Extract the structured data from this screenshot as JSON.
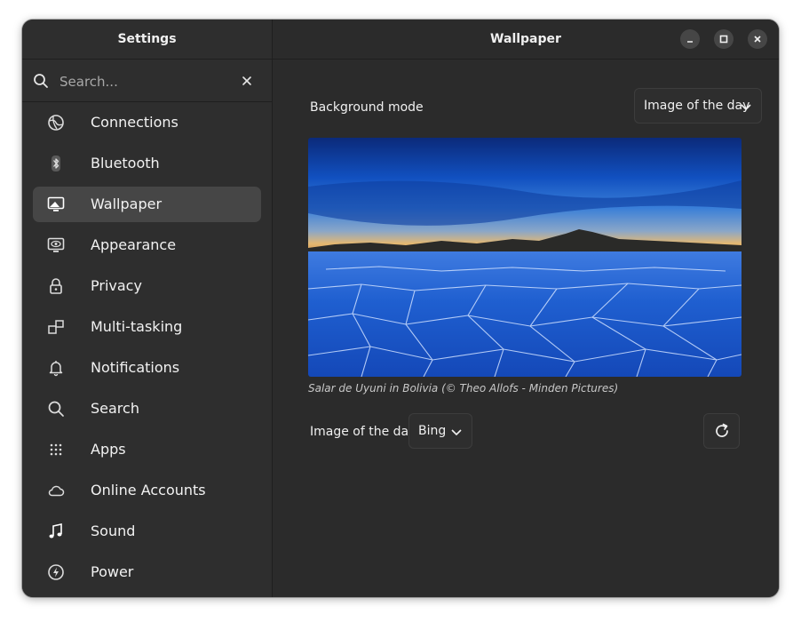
{
  "sidebar": {
    "title": "Settings",
    "search_placeholder": "Search...",
    "items": [
      {
        "label": "Connections",
        "icon": "globe-icon"
      },
      {
        "label": "Bluetooth",
        "icon": "bluetooth-icon"
      },
      {
        "label": "Wallpaper",
        "icon": "display-icon"
      },
      {
        "label": "Appearance",
        "icon": "eye-display-icon"
      },
      {
        "label": "Privacy",
        "icon": "lock-icon"
      },
      {
        "label": "Multi-tasking",
        "icon": "multitasking-icon"
      },
      {
        "label": "Notifications",
        "icon": "bell-icon"
      },
      {
        "label": "Search",
        "icon": "search-icon"
      },
      {
        "label": "Apps",
        "icon": "apps-grid-icon"
      },
      {
        "label": "Online Accounts",
        "icon": "cloud-icon"
      },
      {
        "label": "Sound",
        "icon": "music-note-icon"
      },
      {
        "label": "Power",
        "icon": "power-icon"
      }
    ],
    "active_index": 2
  },
  "main": {
    "title": "Wallpaper",
    "background_mode_label": "Background mode",
    "background_mode_value": "Image of the day",
    "wallpaper_caption": "Salar de Uyuni in Bolivia (© Theo Allofs - Minden Pictures)",
    "image_of_day_label": "Image of the day",
    "image_of_day_source": "Bing"
  },
  "colors": {
    "window_bg": "#2b2b2b",
    "sidebar_bg": "#2e2e2e",
    "active_item_bg": "#464646",
    "text": "#f0f0f0"
  }
}
